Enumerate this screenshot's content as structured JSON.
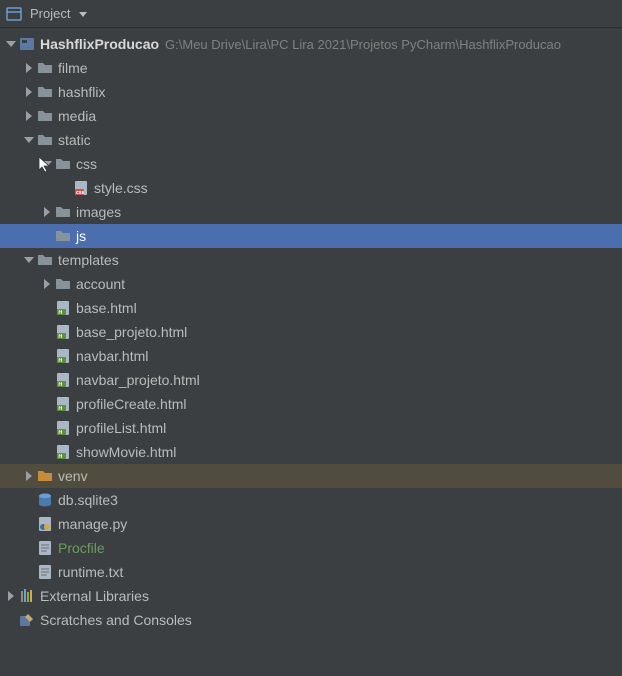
{
  "header": {
    "title": "Project"
  },
  "root": {
    "name": "HashflixProducao",
    "path": "G:\\Meu Drive\\Lira\\PC Lira 2021\\Projetos PyCharm\\HashflixProducao"
  },
  "tree": {
    "filme": "filme",
    "hashflix": "hashflix",
    "media": "media",
    "static": "static",
    "css": "css",
    "stylecss": "style.css",
    "images": "images",
    "js": "js",
    "templates": "templates",
    "account": "account",
    "basehtml": "base.html",
    "baseprojeto": "base_projeto.html",
    "navbar": "navbar.html",
    "navbarprojeto": "navbar_projeto.html",
    "profilecreate": "profileCreate.html",
    "profilelist": "profileList.html",
    "showmovie": "showMovie.html",
    "venv": "venv",
    "dbsqlite": "db.sqlite3",
    "managepy": "manage.py",
    "procfile": "Procfile",
    "runtime": "runtime.txt"
  },
  "footer": {
    "external": "External Libraries",
    "scratches": "Scratches and Consoles"
  }
}
